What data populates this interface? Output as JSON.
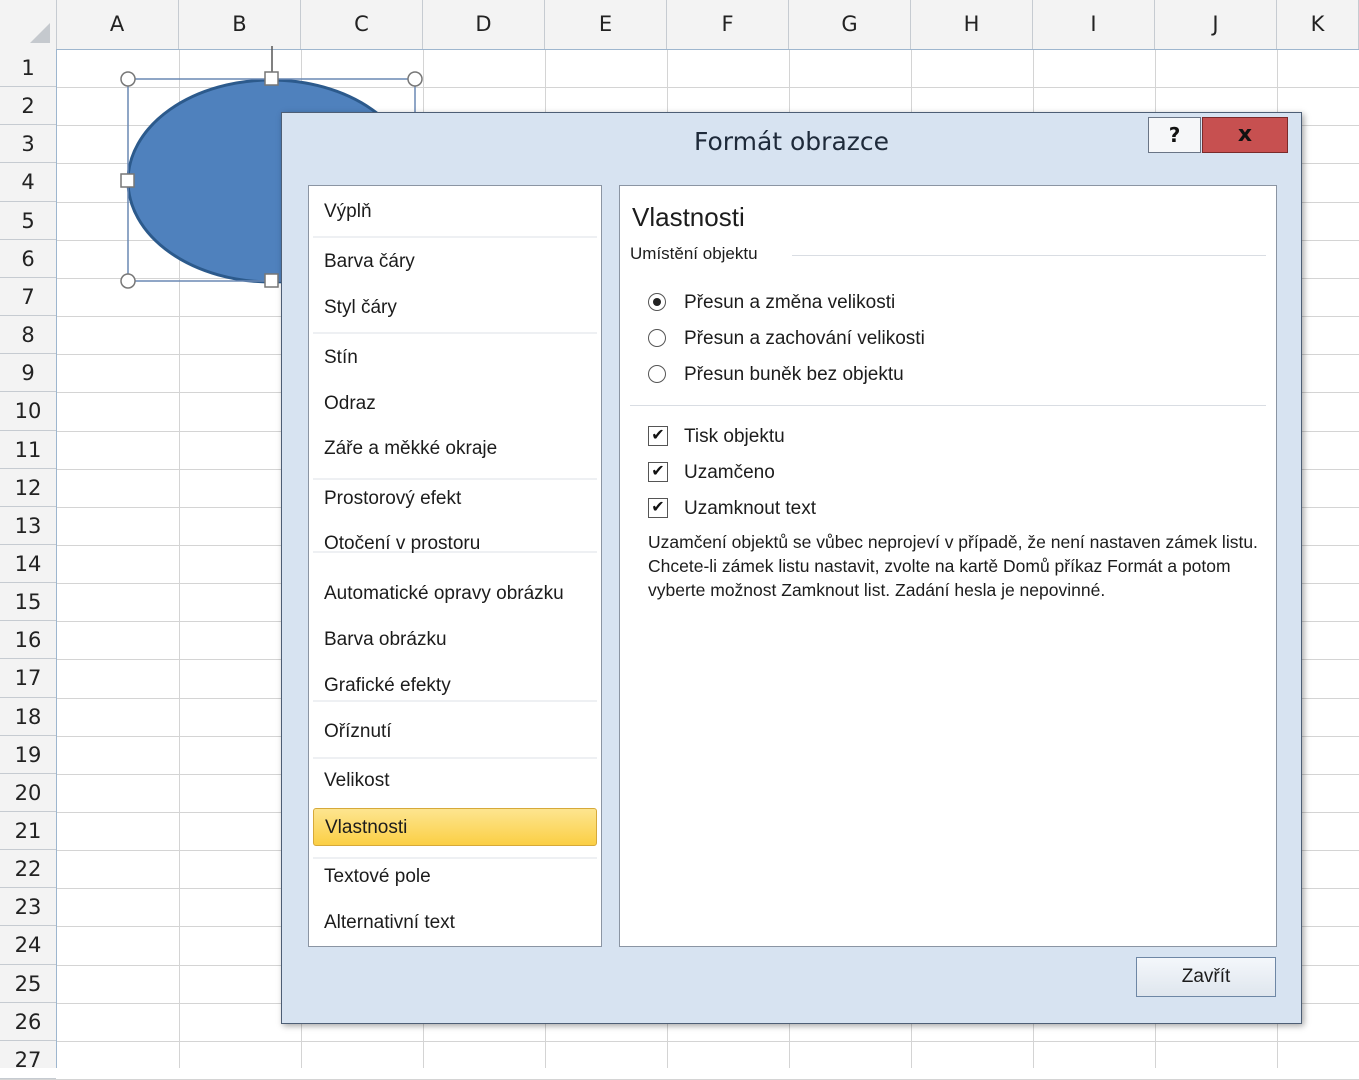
{
  "sheet": {
    "columns": [
      "A",
      "B",
      "C",
      "D",
      "E",
      "F",
      "G",
      "H",
      "I",
      "J",
      "K"
    ],
    "rows": [
      "1",
      "2",
      "3",
      "4",
      "5",
      "6",
      "7",
      "8",
      "9",
      "10",
      "11",
      "12",
      "13",
      "14",
      "15",
      "16",
      "17",
      "18",
      "19",
      "20",
      "21",
      "22",
      "23",
      "24",
      "25",
      "26",
      "27"
    ]
  },
  "shape": {
    "fill": "#4f81bd",
    "stroke": "#2c5a8c"
  },
  "dialog": {
    "title": "Formát obrazce",
    "help_label": "?",
    "close_label": "x",
    "nav_items": [
      {
        "label": "Výplň"
      },
      {
        "label": "Barva čáry"
      },
      {
        "label": "Styl čáry"
      },
      {
        "label": "Stín"
      },
      {
        "label": "Odraz"
      },
      {
        "label": "Záře a měkké okraje"
      },
      {
        "label": "Prostorový efekt"
      },
      {
        "label": "Otočení v prostoru"
      },
      {
        "label": "Automatické opravy obrázku"
      },
      {
        "label": "Barva obrázku"
      },
      {
        "label": "Grafické efekty"
      },
      {
        "label": "Oříznutí"
      },
      {
        "label": "Velikost"
      },
      {
        "label": "Vlastnosti"
      },
      {
        "label": "Textové pole"
      },
      {
        "label": "Alternativní text"
      }
    ],
    "selected_nav": "Vlastnosti",
    "content": {
      "title": "Vlastnosti",
      "group_label": "Umístění objektu",
      "radios": [
        {
          "label": "Přesun a změna velikosti",
          "checked": true
        },
        {
          "label": "Přesun a zachování velikosti",
          "checked": false
        },
        {
          "label": "Přesun buněk bez objektu",
          "checked": false
        }
      ],
      "checkboxes": [
        {
          "label": "Tisk objektu",
          "checked": true
        },
        {
          "label": "Uzamčeno",
          "checked": true
        },
        {
          "label": "Uzamknout text",
          "checked": true
        }
      ],
      "note": "Uzamčení objektů se vůbec neprojeví v případě, že není nastaven zámek listu. Chcete-li zámek listu nastavit, zvolte na kartě Domů příkaz Formát a potom vyberte možnost Zamknout list. Zadání hesla je nepovinné."
    },
    "close_button": "Zavřít"
  }
}
